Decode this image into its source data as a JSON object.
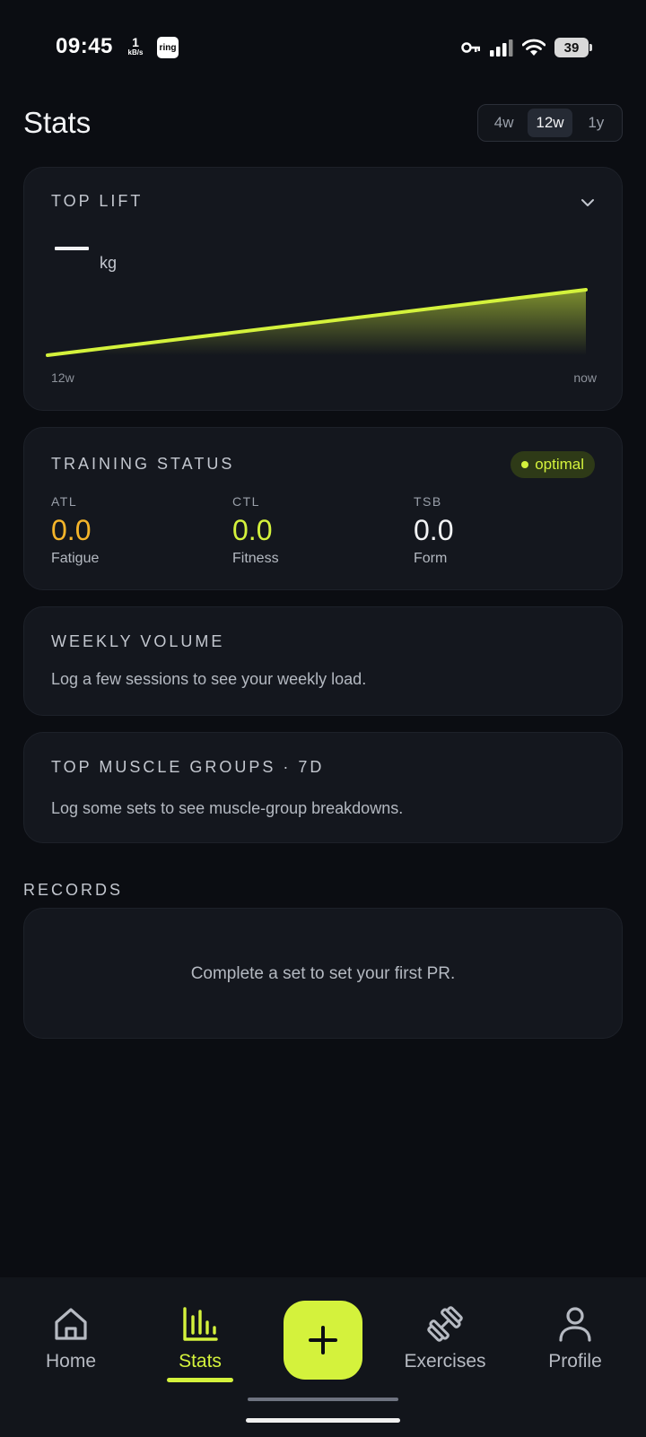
{
  "status_bar": {
    "time": "09:45",
    "net_speed_value": "1",
    "net_speed_unit": "kB/s",
    "notification_app": "ring",
    "battery": "39"
  },
  "header": {
    "title": "Stats",
    "range_options": [
      "4w",
      "12w",
      "1y"
    ],
    "selected_range": "12w"
  },
  "top_lift": {
    "title": "TOP LIFT",
    "value_placeholder": "—",
    "unit": "kg",
    "axis_start": "12w",
    "axis_end": "now",
    "line_color": "#d4f23c"
  },
  "training_status": {
    "title": "TRAINING STATUS",
    "badge": "optimal",
    "metrics": [
      {
        "abbr": "ATL",
        "value": "0.0",
        "label": "Fatigue",
        "color": "#f5b52a"
      },
      {
        "abbr": "CTL",
        "value": "0.0",
        "label": "Fitness",
        "color": "#d4f23c"
      },
      {
        "abbr": "TSB",
        "value": "0.0",
        "label": "Form",
        "color": "#f2f3f5"
      }
    ]
  },
  "weekly_volume": {
    "title": "WEEKLY VOLUME",
    "empty_text": "Log a few sessions to see your weekly load."
  },
  "top_muscle_groups": {
    "title": "TOP MUSCLE GROUPS · 7D",
    "empty_text": "Log some sets to see muscle-group breakdowns."
  },
  "records": {
    "label": "RECORDS",
    "empty_text": "Complete a set to set your first PR."
  },
  "bottom_nav": {
    "items": [
      {
        "label": "Home",
        "icon": "home-icon"
      },
      {
        "label": "Stats",
        "icon": "bar-chart-icon"
      },
      {
        "label": "Exercises",
        "icon": "dumbbell-icon"
      },
      {
        "label": "Profile",
        "icon": "user-icon"
      }
    ],
    "active": "Stats",
    "fab_icon": "plus-icon",
    "accent": "#d4f23c"
  }
}
